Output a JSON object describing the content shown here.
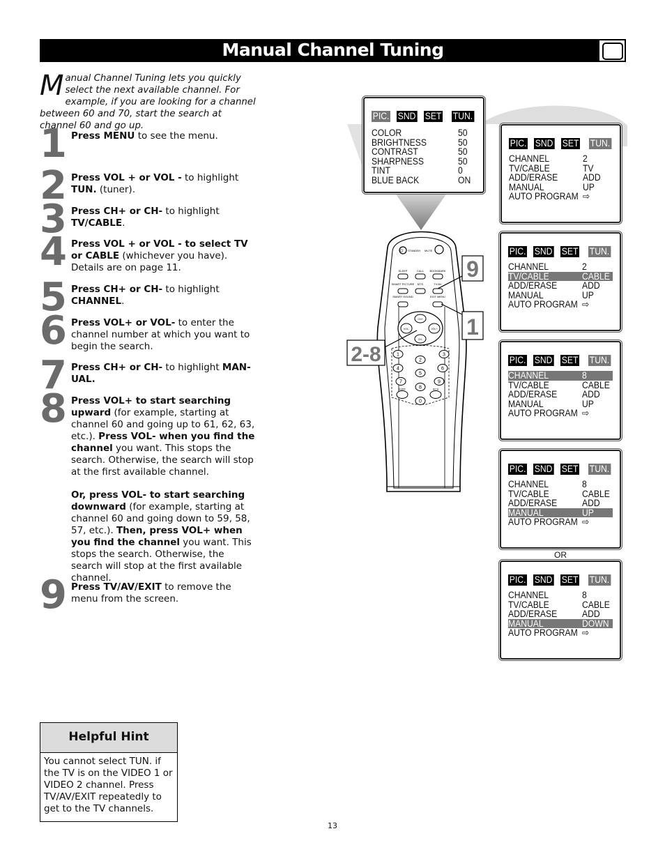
{
  "header": {
    "title": "Manual Channel Tuning",
    "icon": "tv-icon"
  },
  "intro": {
    "dropcap": "M",
    "text": "anual Channel Tuning lets you quickly select the next available channel. For example, if you are looking for a channel between 60 and 70, start the search at channel 60 and go up."
  },
  "steps": [
    {
      "num": "1",
      "bold": "Press MENU",
      "text": " to see the menu."
    },
    {
      "num": "2",
      "bold": "Press VOL + or VOL -",
      "text": " to highlight ",
      "bold2": "TUN.",
      "text2": " (tuner)."
    },
    {
      "num": "3",
      "bold": "Press CH+ or CH-",
      "text": " to highlight ",
      "bold2": "TV/CABLE",
      "text2": "."
    },
    {
      "num": "4",
      "bold": "Press VOL + or VOL - to select TV or CABLE",
      "text": " (whichever you have). Details are on page 11."
    },
    {
      "num": "5",
      "bold": "Press CH+ or CH-",
      "text": " to highlight ",
      "bold2": "CHANNEL",
      "text2": "."
    },
    {
      "num": "6",
      "bold": "Press VOL+ or VOL-",
      "text": " to enter the channel number at which you want to begin the search."
    },
    {
      "num": "7",
      "bold": "Press CH+ or CH-",
      "text": " to highlight ",
      "bold2": "MAN-UAL."
    },
    {
      "num": "8",
      "p1_bold": "Press VOL+ to start searching upward",
      "p1_text": " (for example, starting at channel 60 and going up to 61, 62, 63, etc.). ",
      "p1_bold2": "Press VOL- when you find the channel",
      "p1_text2": " you want. This stops the search. Otherwise, the search will stop at the first available channel.",
      "p2_bold": "Or, press VOL- to start searching downward",
      "p2_text": " (for example, starting at channel 60 and going down to 59, 58, 57, etc.). ",
      "p2_bold2": "Then, press VOL+ when you find the channel",
      "p2_text2": " you want. This stops the search. Otherwise, the search will stop at the first available channel."
    },
    {
      "num": "9",
      "bold": "Press TV/AV/EXIT",
      "text": " to remove the menu from the screen."
    }
  ],
  "hint": {
    "title": "Helpful Hint",
    "body": "You cannot select TUN. if the TV is on the VIDEO 1 or VIDEO 2 channel. Press TV/AV/EXIT repeatedly to get to the TV channels."
  },
  "page_number": "13",
  "osd_tabs": [
    "PIC.",
    "SND",
    "SET",
    "TUN."
  ],
  "osd_menus": [
    {
      "active_tab": 0,
      "highlight": -1,
      "rows": [
        [
          "COLOR",
          "50"
        ],
        [
          "BRIGHTNESS",
          "50"
        ],
        [
          "CONTRAST",
          "50"
        ],
        [
          "SHARPNESS",
          "50"
        ],
        [
          "TINT",
          "0"
        ],
        [
          "BLUE BACK",
          "ON"
        ]
      ]
    },
    {
      "active_tab": 3,
      "highlight": -1,
      "rows": [
        [
          "CHANNEL",
          "2"
        ],
        [
          "TV/CABLE",
          "TV"
        ],
        [
          "ADD/ERASE",
          "ADD"
        ],
        [
          "MANUAL",
          "UP"
        ],
        [
          "AUTO PROGRAM",
          "⇨"
        ]
      ]
    },
    {
      "active_tab": 3,
      "highlight": 1,
      "rows": [
        [
          "CHANNEL",
          "2"
        ],
        [
          "TV/CABLE",
          "CABLE"
        ],
        [
          "ADD/ERASE",
          "ADD"
        ],
        [
          "MANUAL",
          "UP"
        ],
        [
          "AUTO PROGRAM",
          "⇨"
        ]
      ]
    },
    {
      "active_tab": 3,
      "highlight": 0,
      "rows": [
        [
          "CHANNEL",
          "8"
        ],
        [
          "TV/CABLE",
          "CABLE"
        ],
        [
          "ADD/ERASE",
          "ADD"
        ],
        [
          "MANUAL",
          "UP"
        ],
        [
          "AUTO PROGRAM",
          "⇨"
        ]
      ]
    },
    {
      "active_tab": 3,
      "highlight": 3,
      "rows": [
        [
          "CHANNEL",
          "8"
        ],
        [
          "TV/CABLE",
          "CABLE"
        ],
        [
          "ADD/ERASE",
          "ADD"
        ],
        [
          "MANUAL",
          "UP"
        ],
        [
          "AUTO PROGRAM",
          "⇨"
        ]
      ]
    },
    {
      "active_tab": 3,
      "highlight": 3,
      "rows": [
        [
          "CHANNEL",
          "8"
        ],
        [
          "TV/CABLE",
          "CABLE"
        ],
        [
          "ADD/ERASE",
          "ADD"
        ],
        [
          "MANUAL",
          "DOWN"
        ],
        [
          "AUTO PROGRAM",
          "⇨"
        ]
      ]
    }
  ],
  "or_label": "OR",
  "remote": {
    "buttons": {
      "standby": "STANDBY",
      "mute": "MUTE",
      "sleep": "SLEEP",
      "call": "CALL",
      "bookmark": "BOOKMARK",
      "smart_picture": "SMART PICTURE",
      "mts": "MTS",
      "tv_av": "TV/AV",
      "smart_sound": "SMART SOUND",
      "exit_menu": "EXIT MENU",
      "ch_up": "CH+",
      "ch_down": "CH-",
      "vol_up": "VOL+",
      "vol_down": "VOL-",
      "digits": [
        "1",
        "2",
        "3",
        "4",
        "5",
        "6",
        "7",
        "8",
        "9",
        "0"
      ],
      "surf": "SURF",
      "a_ch": "A/CH"
    },
    "callouts": [
      "9",
      "1",
      "2-8"
    ]
  }
}
